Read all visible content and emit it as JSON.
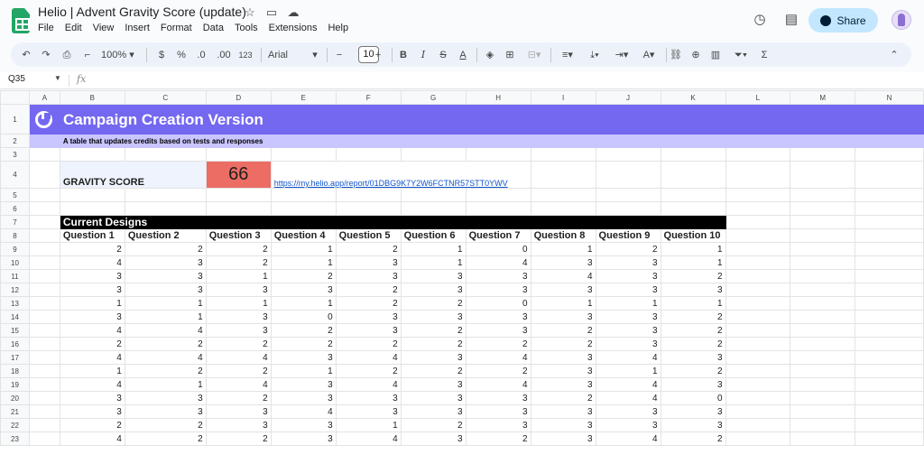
{
  "app": {
    "title": "Helio | Advent Gravity Score (update)",
    "menu": [
      "File",
      "Edit",
      "View",
      "Insert",
      "Format",
      "Data",
      "Tools",
      "Extensions",
      "Help"
    ],
    "share_label": "Share"
  },
  "toolbar": {
    "zoom": "100%",
    "currency": "$",
    "percent": "%",
    "dec_decrease": ".0",
    "dec_increase": ".00",
    "number_format": "123",
    "font": "Arial",
    "font_size": "10"
  },
  "formula_bar": {
    "cell_ref": "Q35",
    "fx": "fx"
  },
  "columns": [
    "A",
    "B",
    "C",
    "D",
    "E",
    "F",
    "G",
    "H",
    "I",
    "J",
    "K",
    "L",
    "M",
    "N"
  ],
  "sheet": {
    "row_numbers": [
      "1",
      "2",
      "3",
      "4",
      "5",
      "6",
      "7",
      "8",
      "9",
      "10",
      "11",
      "12",
      "13",
      "14",
      "15",
      "16",
      "17",
      "18",
      "19",
      "20",
      "21",
      "22",
      "23"
    ],
    "title": "Campaign Creation Version",
    "subtitle": "A table that updates credits based on tests and responses",
    "gravity_label": "GRAVITY SCORE",
    "gravity_value": "66",
    "report_link": "https://my.helio.app/report/01DBG9K7Y2W6FCTNR57STT0YWV",
    "current_designs": "Current Designs",
    "question_headers": [
      "Question 1",
      "Question 2",
      "Question 3",
      "Question 4",
      "Question 5",
      "Question 6",
      "Question 7",
      "Question 8",
      "Question 9",
      "Question 10"
    ],
    "data_rows": [
      [
        2,
        2,
        2,
        1,
        2,
        1,
        0,
        1,
        2,
        1
      ],
      [
        4,
        3,
        2,
        1,
        3,
        1,
        4,
        3,
        3,
        1
      ],
      [
        3,
        3,
        1,
        2,
        3,
        3,
        3,
        4,
        3,
        2
      ],
      [
        3,
        3,
        3,
        3,
        2,
        3,
        3,
        3,
        3,
        3
      ],
      [
        1,
        1,
        1,
        1,
        2,
        2,
        0,
        1,
        1,
        1
      ],
      [
        3,
        1,
        3,
        0,
        3,
        3,
        3,
        3,
        3,
        2
      ],
      [
        4,
        4,
        3,
        2,
        3,
        2,
        3,
        2,
        3,
        2
      ],
      [
        2,
        2,
        2,
        2,
        2,
        2,
        2,
        2,
        3,
        2
      ],
      [
        4,
        4,
        4,
        3,
        4,
        3,
        4,
        3,
        4,
        3
      ],
      [
        1,
        2,
        2,
        1,
        2,
        2,
        2,
        3,
        1,
        2
      ],
      [
        4,
        1,
        4,
        3,
        4,
        3,
        4,
        3,
        4,
        3
      ],
      [
        3,
        3,
        2,
        3,
        3,
        3,
        3,
        2,
        4,
        0
      ],
      [
        3,
        3,
        3,
        4,
        3,
        3,
        3,
        3,
        3,
        3
      ],
      [
        2,
        2,
        3,
        3,
        1,
        2,
        3,
        3,
        3,
        3
      ],
      [
        4,
        2,
        2,
        3,
        4,
        3,
        2,
        3,
        4,
        2
      ]
    ]
  },
  "colors": {
    "title_bg": "#7467f0",
    "subtitle_bg": "#c9c5ff",
    "score_bg": "#ec6d63",
    "label_bg": "#eef3fd",
    "header_bar_bg": "#000000",
    "share_bg": "#c2e7ff",
    "logo_green": "#23a566"
  }
}
